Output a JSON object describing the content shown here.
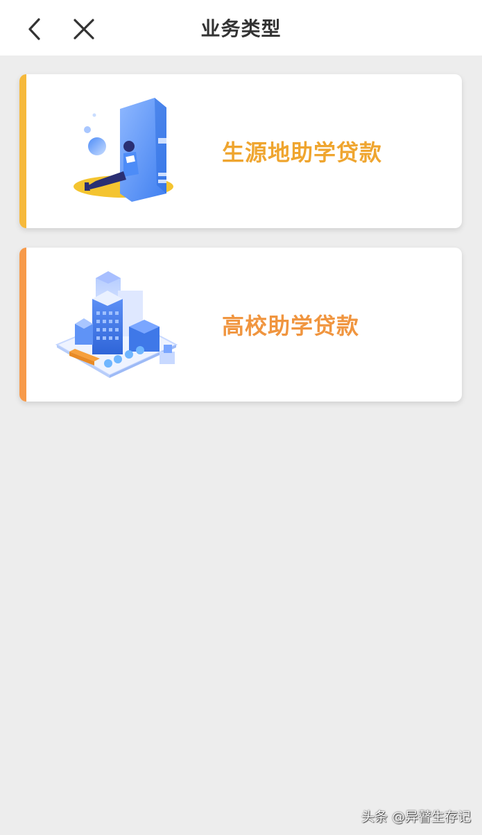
{
  "header": {
    "title": "业务类型",
    "back_icon": "chevron-left-icon",
    "close_icon": "close-icon"
  },
  "cards": [
    {
      "label": "生源地助学贷款",
      "accent_color": "#f6b93b",
      "label_color": "#efa52f",
      "illustration": "student-reading-book-illustration"
    },
    {
      "label": "高校助学贷款",
      "accent_color": "#f79a4a",
      "label_color": "#f0953f",
      "illustration": "campus-buildings-illustration"
    }
  ],
  "watermark": {
    "text": "头条 @异瞽生存记"
  }
}
